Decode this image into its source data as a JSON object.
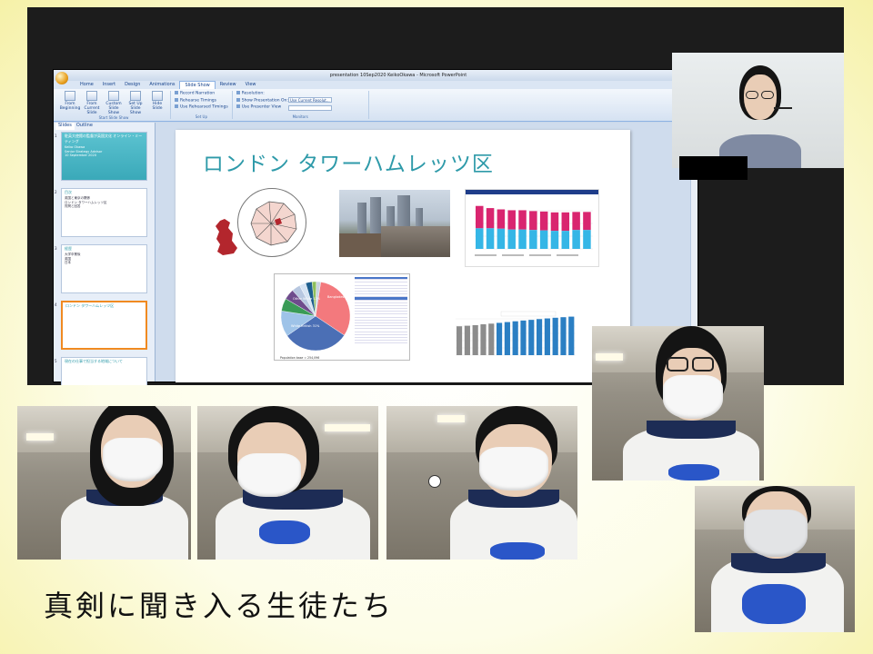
{
  "window": {
    "title": "presentation 10Sep2020 KeikoOkawa - Microsoft PowerPoint"
  },
  "ribbon": {
    "tabs": [
      "Home",
      "Insert",
      "Design",
      "Animations",
      "Slide Show",
      "Review",
      "View"
    ],
    "active_tab": "Slide Show",
    "start_group": {
      "title": "Start Slide Show",
      "buttons": [
        "From Beginning",
        "From Current Slide",
        "Custom Slide Show",
        "Set Up Slide Show",
        "Hide Slide"
      ]
    },
    "setup_group": {
      "title": "Set Up",
      "items": [
        "Record Narration",
        "Rehearse Timings",
        "Use Rehearsed Timings"
      ]
    },
    "monitors_group": {
      "title": "Monitors",
      "items": [
        "Resolution:",
        "Show Presentation On:",
        "Use Presenter View"
      ],
      "resolution_value": "Use Current Resolut..."
    }
  },
  "slide_panel": {
    "tabs": [
      "Slides",
      "Outline"
    ],
    "thumbs": [
      {
        "num": "1",
        "title": "駐英大使館の監督が英国文化 オンライン・ミーティング",
        "lines": [
          "Keiko Okawa",
          "Senior Strategy Advisor",
          "10 September 2020"
        ]
      },
      {
        "num": "2",
        "title": "目次",
        "lines": [
          "英国と東京の関係",
          "ロンドン タワーハムレッツ区",
          "質問と回答"
        ]
      },
      {
        "num": "3",
        "title": "経歴",
        "lines": [
          "大学卒業後",
          "英国",
          "日本"
        ]
      },
      {
        "num": "4",
        "title": "ロンドン タワーハムレッツ区",
        "lines": []
      },
      {
        "num": "5",
        "title": "現在の仕事で担当する地域について",
        "lines": []
      }
    ]
  },
  "slide": {
    "title": "ロンドン タワーハムレッツ区",
    "pie_labels": [
      "Bangladeshi 32%",
      "White British 31%",
      "Other White 12%"
    ],
    "pie_footer": "Population base = 254,096"
  },
  "chart_data": [
    {
      "type": "bar",
      "categories": [
        "1",
        "2",
        "3",
        "4",
        "5",
        "6",
        "7",
        "8",
        "9",
        "10",
        "11"
      ],
      "series": [
        {
          "values": [
            100,
            95,
            92,
            90,
            90,
            88,
            87,
            85,
            85,
            86,
            86
          ]
        },
        {
          "values": [
            48,
            48,
            47,
            45,
            45,
            44,
            43,
            42,
            42,
            44,
            44
          ]
        }
      ]
    },
    {
      "type": "pie",
      "values": [
        32,
        31,
        12,
        6,
        5,
        4,
        3,
        3,
        2,
        2
      ]
    },
    {
      "type": "bar",
      "values": [
        260,
        265,
        270,
        278,
        284,
        291,
        298,
        305,
        312,
        318,
        325,
        331,
        337,
        342,
        347
      ]
    }
  ],
  "colors": {
    "accent": "#2e9aa9",
    "bar_magenta": "#d9256f",
    "bar_cyan": "#35b6e6",
    "ribbon_blue": "#15428b"
  },
  "caption": "真剣に聞き入る生徒たち"
}
